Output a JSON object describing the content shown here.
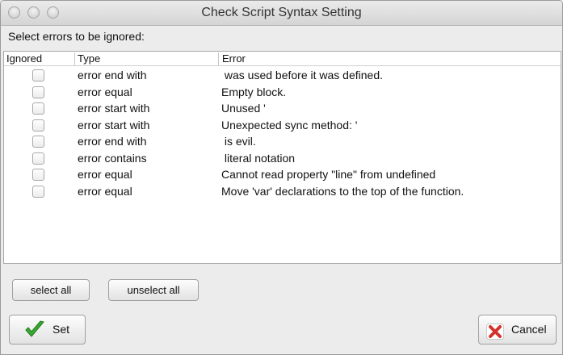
{
  "window": {
    "title": "Check Script Syntax Setting"
  },
  "prompt": "Select errors to be ignored:",
  "table": {
    "columns": [
      "Ignored",
      "Type",
      "Error"
    ],
    "rows": [
      {
        "ignored": false,
        "type": "error end with",
        "error": " was used before it was defined."
      },
      {
        "ignored": false,
        "type": "error equal",
        "error": "Empty block."
      },
      {
        "ignored": false,
        "type": "error start with",
        "error": "Unused '"
      },
      {
        "ignored": false,
        "type": "error start with",
        "error": "Unexpected sync method: '"
      },
      {
        "ignored": false,
        "type": "error end with",
        "error": " is evil."
      },
      {
        "ignored": false,
        "type": "error contains",
        "error": " literal notation"
      },
      {
        "ignored": false,
        "type": "error equal",
        "error": "Cannot read property \"line\" from undefined"
      },
      {
        "ignored": false,
        "type": "error equal",
        "error": "Move 'var' declarations to the top of the function."
      }
    ]
  },
  "buttons": {
    "select_all": "select all",
    "unselect_all": "unselect all",
    "set": "Set",
    "cancel": "Cancel"
  },
  "icons": {
    "set": "checkmark-icon",
    "cancel": "cross-icon"
  },
  "colors": {
    "check_green": "#3aa832",
    "cancel_red": "#d4322c"
  }
}
